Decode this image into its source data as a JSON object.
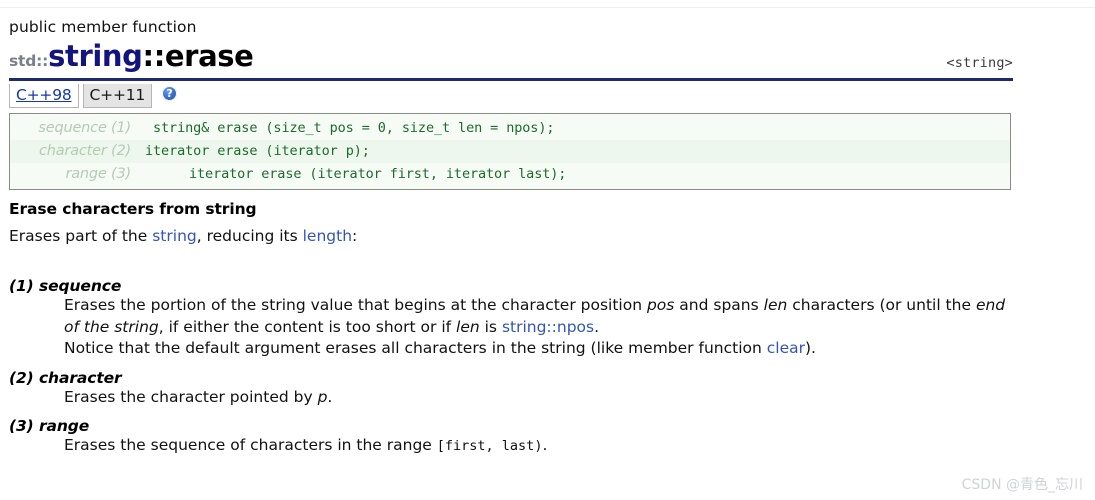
{
  "header": {
    "kicker": "public member function",
    "namespace": "std::",
    "class_name": "string",
    "member_name": "::erase",
    "include_header": "<string>",
    "rule_color": "#1d2a6e"
  },
  "tabs": {
    "items": [
      {
        "label": "C++98",
        "active": true
      },
      {
        "label": "C++11",
        "active": false
      }
    ],
    "help_icon_glyph": "?",
    "help_icon_name": "help-question-icon",
    "active_color": "#1637b4"
  },
  "signatures": [
    {
      "label": "sequence (1)",
      "code": "string& erase (size_t pos = 0, size_t len = npos);"
    },
    {
      "label": "character (2)",
      "code": "iterator erase (iterator p);"
    },
    {
      "label": "range (3)",
      "code": "iterator erase (iterator first, iterator last);"
    }
  ],
  "signature_colors": {
    "code": "#1d6b2b",
    "label": "#b2ccb2",
    "background": "#f6fbf6",
    "stripe": "#eef7ee",
    "border": "#8a8a8a"
  },
  "description": {
    "heading": "Erase characters from string",
    "lede_part1": "Erases part of the ",
    "lede_link1": "string",
    "lede_part2": ", reducing its ",
    "lede_link2": "length",
    "lede_part3": ":"
  },
  "parameters": [
    {
      "term": "(1) sequence",
      "lines": [
        {
          "segments": [
            {
              "text": "Erases the portion of the string value that begins at the character position ",
              "style": "normal"
            },
            {
              "text": "pos",
              "style": "italic"
            },
            {
              "text": " and spans ",
              "style": "normal"
            },
            {
              "text": "len",
              "style": "italic"
            },
            {
              "text": " characters (or until the ",
              "style": "normal"
            },
            {
              "text": "end of the string",
              "style": "italic"
            },
            {
              "text": ", if either the content is too short or if ",
              "style": "normal"
            },
            {
              "text": "len",
              "style": "italic"
            },
            {
              "text": " is ",
              "style": "normal"
            },
            {
              "text": "string::npos",
              "style": "link"
            },
            {
              "text": ".",
              "style": "normal"
            }
          ]
        },
        {
          "segments": [
            {
              "text": "Notice that the default argument erases all characters in the string (like member function ",
              "style": "normal"
            },
            {
              "text": "clear",
              "style": "link"
            },
            {
              "text": ").",
              "style": "normal"
            }
          ]
        }
      ]
    },
    {
      "term": "(2) character",
      "lines": [
        {
          "segments": [
            {
              "text": "Erases the character pointed by ",
              "style": "normal"
            },
            {
              "text": "p",
              "style": "italic"
            },
            {
              "text": ".",
              "style": "normal"
            }
          ]
        }
      ]
    },
    {
      "term": "(3) range",
      "lines": [
        {
          "segments": [
            {
              "text": "Erases the sequence of characters in the range ",
              "style": "normal"
            },
            {
              "text": "[first, last)",
              "style": "mono"
            },
            {
              "text": ".",
              "style": "normal"
            }
          ]
        }
      ]
    }
  ],
  "watermark": {
    "text": "CSDN @青色_忘川",
    "color": "#cfd2d6"
  }
}
